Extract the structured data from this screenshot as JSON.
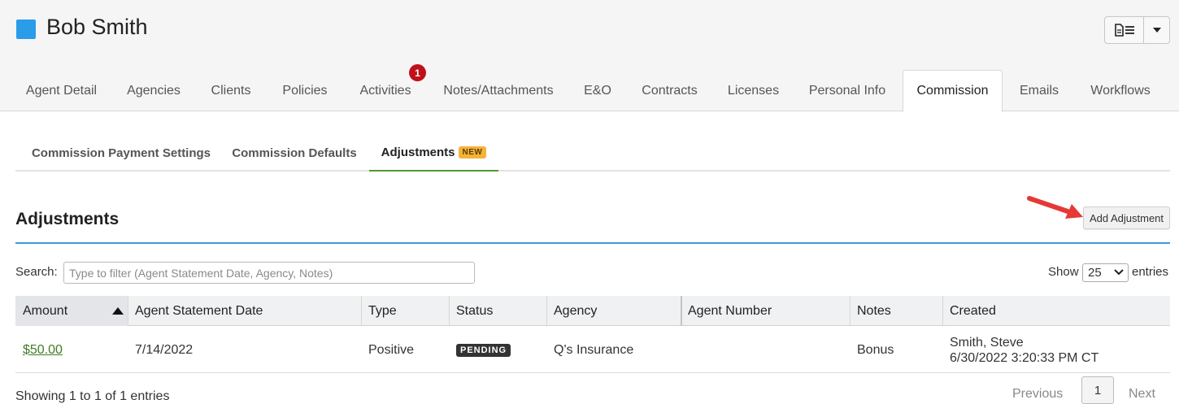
{
  "header": {
    "agent_name": "Bob Smith",
    "agent_color": "#2a9ce8"
  },
  "tabs": [
    {
      "label": "Agent Detail"
    },
    {
      "label": "Agencies"
    },
    {
      "label": "Clients"
    },
    {
      "label": "Policies"
    },
    {
      "label": "Activities",
      "badge": "1"
    },
    {
      "label": "Notes/Attachments"
    },
    {
      "label": "E&O"
    },
    {
      "label": "Contracts"
    },
    {
      "label": "Licenses"
    },
    {
      "label": "Personal Info"
    },
    {
      "label": "Commission",
      "active": true
    },
    {
      "label": "Emails"
    },
    {
      "label": "Workflows"
    }
  ],
  "subtabs": [
    {
      "label": "Commission Payment Settings"
    },
    {
      "label": "Commission Defaults"
    },
    {
      "label": "Adjustments",
      "badge": "NEW",
      "active": true
    }
  ],
  "section": {
    "title": "Adjustments",
    "add_button": "Add Adjustment"
  },
  "search": {
    "label": "Search:",
    "placeholder": "Type to filter (Agent Statement Date, Agency, Notes)"
  },
  "length": {
    "show": "Show",
    "value": "25",
    "entries": "entries"
  },
  "table": {
    "columns": [
      "Amount",
      "Agent Statement Date",
      "Type",
      "Status",
      "Agency",
      "Agent Number",
      "Notes",
      "Created"
    ],
    "sorted_column": "Amount",
    "rows": [
      {
        "amount": "$50.00",
        "statement_date": "7/14/2022",
        "type": "Positive",
        "status": "PENDING",
        "agency": "Q's Insurance",
        "agent_number": "",
        "notes": "Bonus",
        "created_by": "Smith, Steve",
        "created_at": "6/30/2022 3:20:33 PM CT"
      }
    ]
  },
  "footer": {
    "info": "Showing 1 to 1 of 1 entries",
    "previous": "Previous",
    "page": "1",
    "next": "Next"
  },
  "colors": {
    "accent_blue": "#3d9ad9",
    "active_green": "#4e9b2e",
    "badge_red": "#c0101a",
    "new_badge": "#f5b33a",
    "annotation_arrow": "#e53935"
  }
}
